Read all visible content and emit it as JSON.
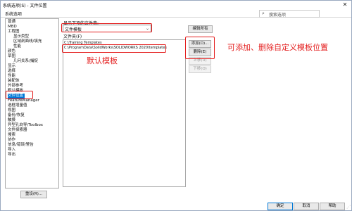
{
  "window": {
    "title": "系统选项(S) - 文件位置",
    "controls": {
      "close": "✕"
    }
  },
  "tabs": {
    "system_options": "系统选项"
  },
  "search": {
    "placeholder": "搜索选项",
    "icon": "search-icon"
  },
  "tree": {
    "items": [
      {
        "label": "普通"
      },
      {
        "label": "MBD"
      },
      {
        "label": "工程图"
      },
      {
        "label": "显示类型"
      },
      {
        "label": "区域剖面线/填充"
      },
      {
        "label": "性能"
      },
      {
        "label": "颜色"
      },
      {
        "label": "草图"
      },
      {
        "label": "几何关系/捕捉"
      },
      {
        "label": "显示"
      },
      {
        "label": "选择"
      },
      {
        "label": "性能"
      },
      {
        "label": "装配体"
      },
      {
        "label": "外部参考"
      },
      {
        "label": "默认模板"
      },
      {
        "label": "文件位置"
      },
      {
        "label": "FeatureManager"
      },
      {
        "label": "选框增量值"
      },
      {
        "label": "视图"
      },
      {
        "label": "备份/恢复"
      },
      {
        "label": "触摸"
      },
      {
        "label": "异型孔向导/Toolbox"
      },
      {
        "label": "文件探索器"
      },
      {
        "label": "搜索"
      },
      {
        "label": "协作"
      },
      {
        "label": "信息/错误/警告"
      },
      {
        "label": "导入"
      },
      {
        "label": "导出"
      }
    ],
    "selected": "文件位置"
  },
  "reset_button": "重设(R)...",
  "main": {
    "show_folders_label": "显示下项的文件夹:",
    "dropdown_value": "文件模板",
    "edit_all_button": "编辑所有",
    "folders_label": "文件夹(F)",
    "folders": [
      "C:\\Training Templates",
      "C:\\ProgramData\\SolidWorks\\SOLIDWORKS 2020\\templates"
    ],
    "buttons": {
      "add": "添加(D)...",
      "delete": "删除(E)",
      "up": "上移(U)",
      "down": "下移(O)"
    }
  },
  "annotations": {
    "default_template": "默认模板",
    "add_delete": "可添加、删除自定义模板位置"
  },
  "footer": {
    "ok": "确定",
    "cancel": "取消",
    "help": "帮助"
  },
  "colors": {
    "annotation_red": "#e41f1f",
    "selection_blue": "#0078d7"
  }
}
